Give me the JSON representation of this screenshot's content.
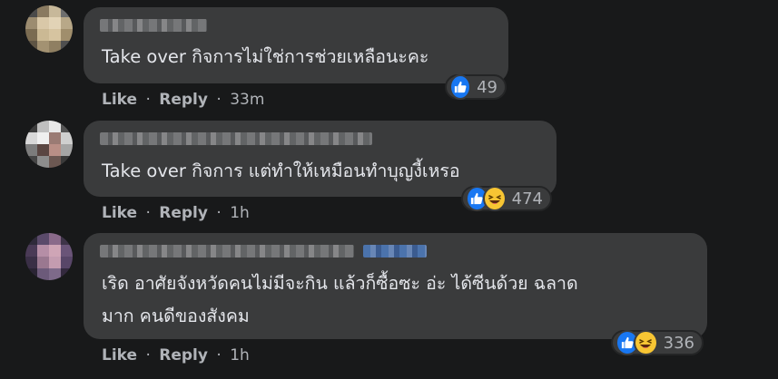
{
  "comments": [
    {
      "text_line1": "Take over กิจการไม่ใช่การช่วยเหลือนะคะ",
      "text_line2": "",
      "like_label": "Like",
      "reply_label": "Reply",
      "time": "33m",
      "reaction_count": "49",
      "reactions": [
        "like-icon"
      ]
    },
    {
      "text_line1": "Take over กิจการ แต่ทำให้เหมือนทำบุญงี้เหรอ",
      "text_line2": "",
      "like_label": "Like",
      "reply_label": "Reply",
      "time": "1h",
      "reaction_count": "474",
      "reactions": [
        "like-icon",
        "haha-icon"
      ]
    },
    {
      "text_line1": "เริด อาศัยจังหวัดคนไม่มีจะกิน แล้วก็ซื้อซะ อ่ะ ได้ซีนด้วย ฉลาด",
      "text_line2": "มาก คนดีของสังคม",
      "like_label": "Like",
      "reply_label": "Reply",
      "time": "1h",
      "reaction_count": "336",
      "reactions": [
        "like-icon",
        "haha-icon"
      ]
    }
  ],
  "separator": "·",
  "colors": {
    "background": "#18191a",
    "bubble": "#3a3b3c",
    "text": "#e4e6eb",
    "secondary": "#b0b3b8",
    "like_blue": "#1877f2",
    "haha_yellow": "#f7c533"
  }
}
